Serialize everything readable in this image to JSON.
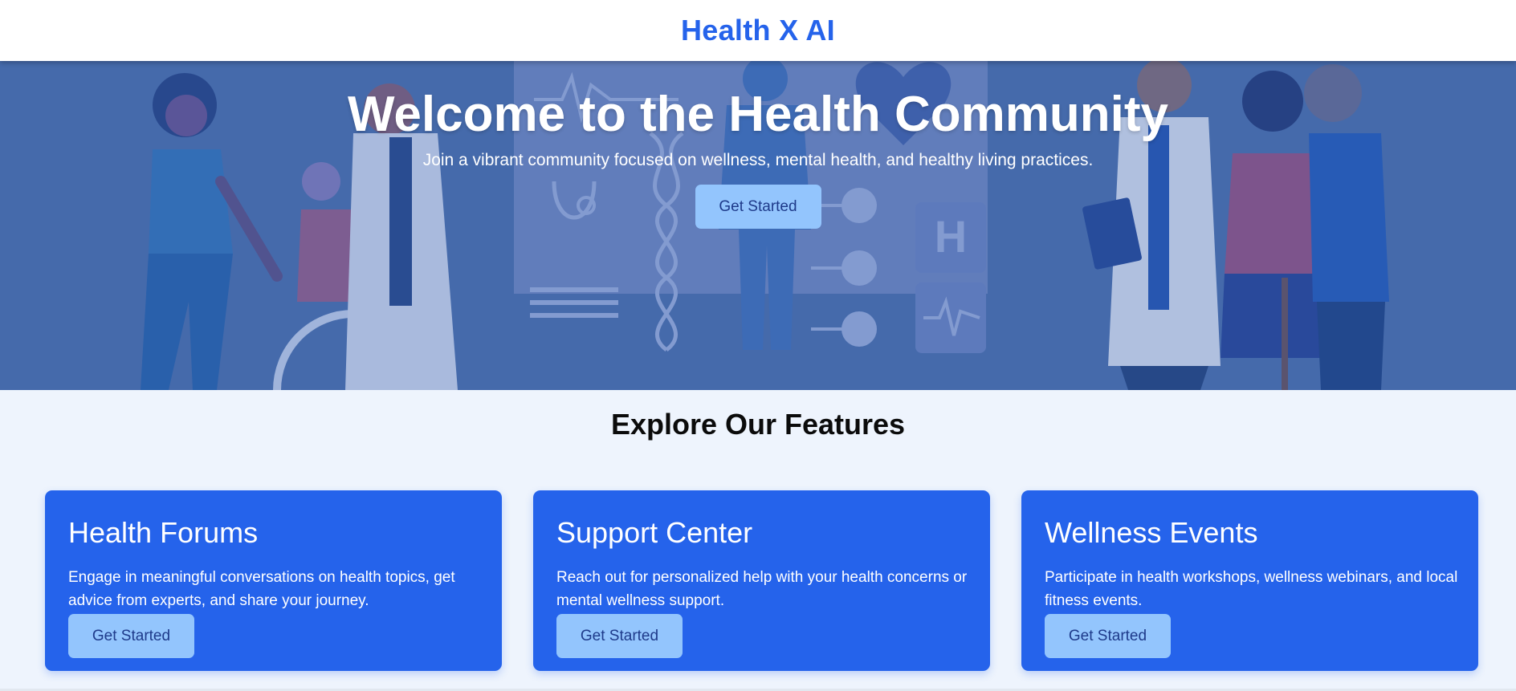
{
  "header": {
    "brand": "Health X AI"
  },
  "hero": {
    "title": "Welcome to the Health Community",
    "subtitle": "Join a vibrant community focused on wellness, mental health, and healthy living practices.",
    "cta_label": "Get Started"
  },
  "features": {
    "heading": "Explore Our Features",
    "cards": [
      {
        "title": "Health Forums",
        "description": "Engage in meaningful conversations on health topics, get advice from experts, and share your journey.",
        "cta_label": "Get Started"
      },
      {
        "title": "Support Center",
        "description": "Reach out for personalized help with your health concerns or mental wellness support.",
        "cta_label": "Get Started"
      },
      {
        "title": "Wellness Events",
        "description": "Participate in health workshops, wellness webinars, and local fitness events.",
        "cta_label": "Get Started"
      }
    ]
  },
  "colors": {
    "brand": "#2563eb",
    "button_bg": "#93c5fd",
    "button_text": "#1e3a8a",
    "page_bg": "#eef4fd",
    "hero_overlay": "#4a6ea8"
  },
  "icons": {
    "hero_illustration": "healthcare-team-illustration"
  }
}
